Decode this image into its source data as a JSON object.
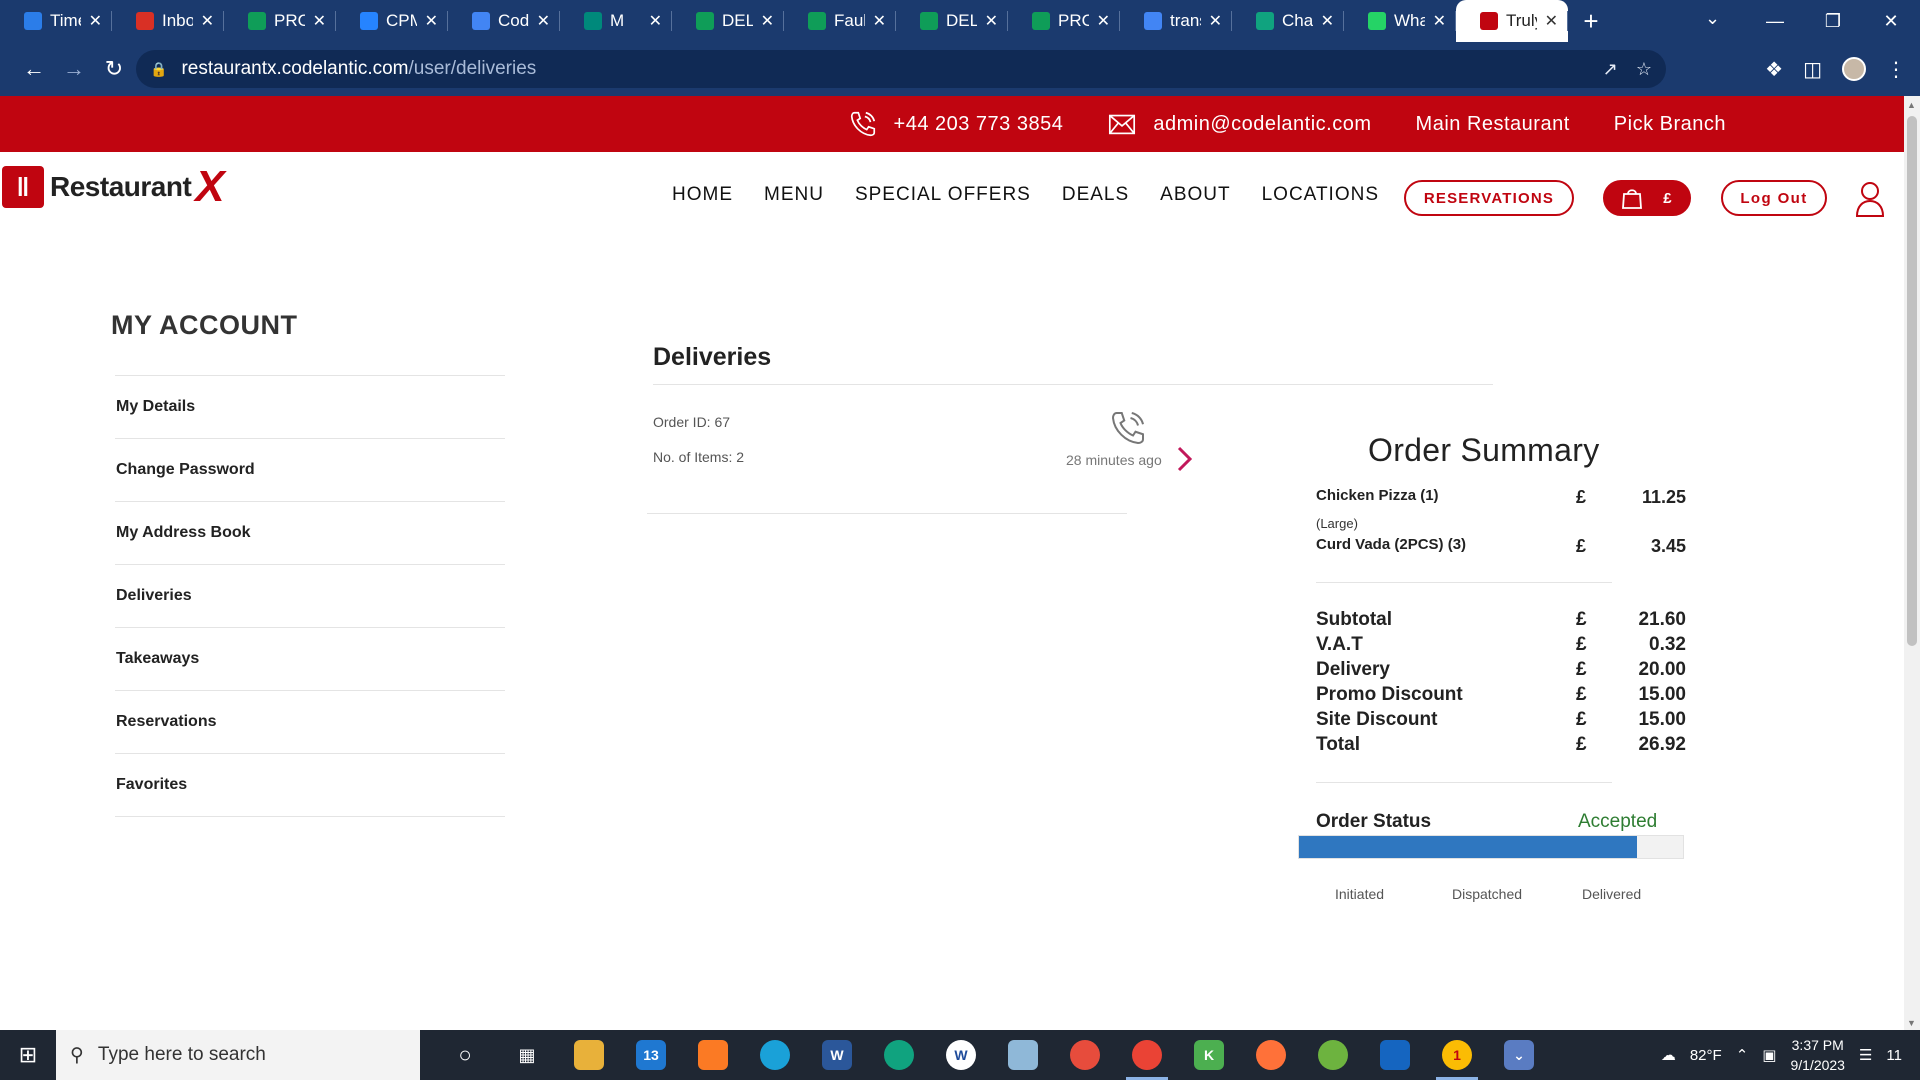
{
  "browser": {
    "tabs": [
      {
        "label": "Time",
        "icon": "clock-favicon",
        "color": "#2b7de9"
      },
      {
        "label": "Inbox",
        "icon": "gmail-favicon",
        "color": "#d93025"
      },
      {
        "label": "PROD",
        "icon": "sheets-favicon",
        "color": "#0f9d58"
      },
      {
        "label": "CPM",
        "icon": "jira-favicon",
        "color": "#2684ff"
      },
      {
        "label": "Code",
        "icon": "calendar-favicon",
        "color": "#4285f4"
      },
      {
        "label": "M",
        "icon": "meet-favicon",
        "color": "#00897b"
      },
      {
        "label": "DELIV",
        "icon": "sheets-favicon",
        "color": "#0f9d58"
      },
      {
        "label": "Fault",
        "icon": "sheets-favicon",
        "color": "#0f9d58"
      },
      {
        "label": "DELIV",
        "icon": "sheets-favicon",
        "color": "#0f9d58"
      },
      {
        "label": "PROD",
        "icon": "sheets-favicon",
        "color": "#0f9d58"
      },
      {
        "label": "trans",
        "icon": "google-favicon",
        "color": "#4285f4"
      },
      {
        "label": "Chat",
        "icon": "chatgpt-favicon",
        "color": "#10a37f"
      },
      {
        "label": "What",
        "icon": "whatsapp-favicon",
        "color": "#25d366"
      },
      {
        "label": "Truly",
        "icon": "restaurantx-favicon",
        "color": "#c00510"
      }
    ],
    "url_host": "restaurantx.codelantic.com",
    "url_path": "/user/deliveries"
  },
  "site": {
    "phone": "+44 203 773 3854",
    "email": "admin@codelantic.com",
    "restaurant": "Main Restaurant",
    "branch": "Pick Branch",
    "logo_text": "Restaurant",
    "nav": [
      "HOME",
      "MENU",
      "SPECIAL OFFERS",
      "DEALS",
      "ABOUT",
      "LOCATIONS"
    ],
    "reservations_btn": "RESERVATIONS",
    "cart_currency": "£",
    "logout_btn": "Log Out",
    "brand_color": "#c00510"
  },
  "account": {
    "title": "MY ACCOUNT",
    "menu": [
      "My Details",
      "Change Password",
      "My Address Book",
      "Deliveries",
      "Takeaways",
      "Reservations",
      "Favorites"
    ]
  },
  "deliveries": {
    "title": "Deliveries",
    "order_id": "Order ID: 67",
    "items": "No. of Items: 2",
    "time": "28 minutes ago"
  },
  "summary": {
    "title": "Order Summary",
    "lines": [
      {
        "name": "Chicken Pizza (1)",
        "currency": "£",
        "amount": "11.25",
        "option": "(Large)"
      },
      {
        "name": "Curd Vada (2PCS) (3)",
        "currency": "£",
        "amount": "3.45"
      }
    ],
    "totals": [
      {
        "name": "Subtotal",
        "currency": "£",
        "amount": "21.60"
      },
      {
        "name": "V.A.T",
        "currency": "£",
        "amount": "0.32"
      },
      {
        "name": "Delivery",
        "currency": "£",
        "amount": "20.00"
      },
      {
        "name": "Promo Discount",
        "currency": "£",
        "amount": "15.00"
      },
      {
        "name": "Site Discount",
        "currency": "£",
        "amount": "15.00"
      },
      {
        "name": "Total",
        "currency": "£",
        "amount": "26.92"
      }
    ],
    "status_label": "Order Status",
    "status_value": "Accepted",
    "status_color": "#2e7d32",
    "progress_percent": 88,
    "progress_color": "#2f77c0",
    "steps": [
      "Initiated",
      "Dispatched",
      "Delivered"
    ]
  },
  "taskbar": {
    "search_placeholder": "Type here to search",
    "mail_badge": "13",
    "notif_badge": "1",
    "weather": "82°F",
    "time": "3:37 PM",
    "date": "9/1/2023",
    "notif_count": "11"
  }
}
